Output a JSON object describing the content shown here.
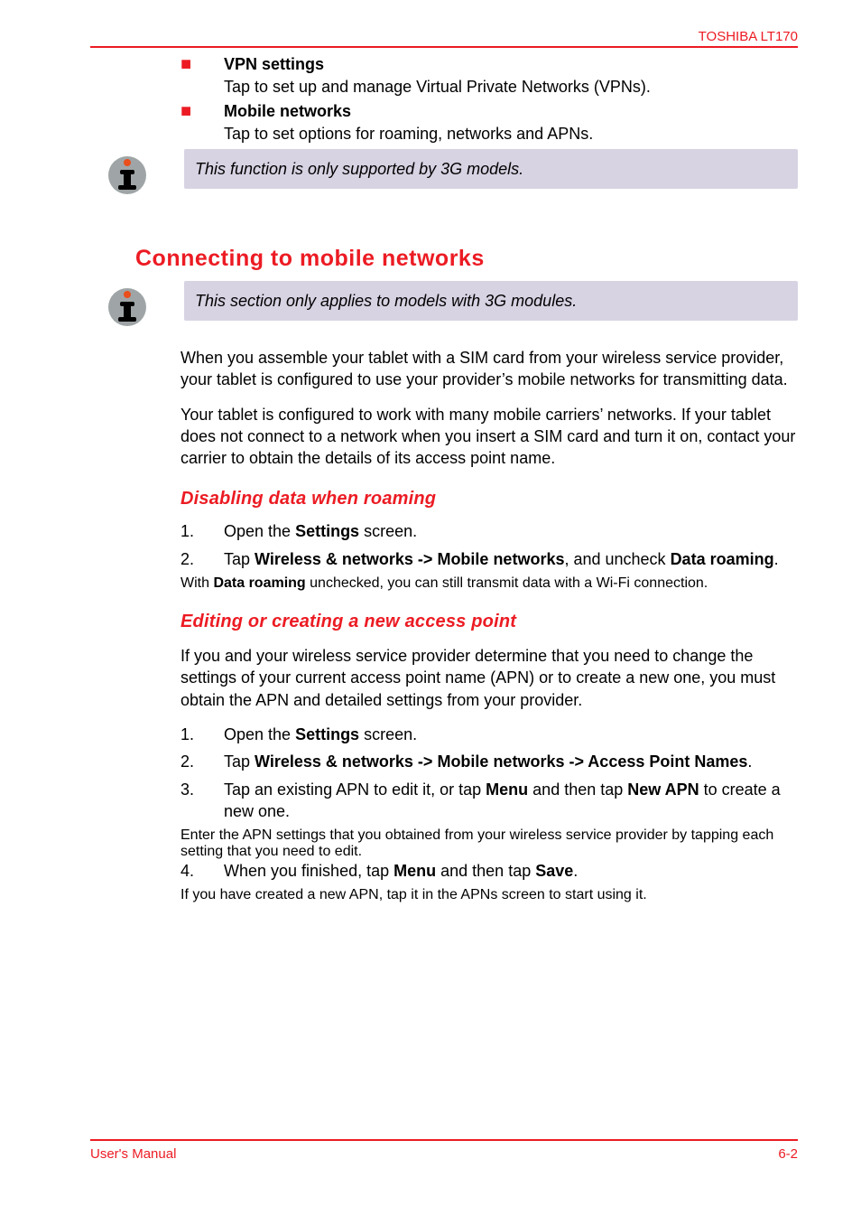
{
  "header": {
    "product": "TOSHIBA LT170"
  },
  "top_bullets": [
    {
      "label": "VPN settings",
      "desc": "Tap to set up and manage Virtual Private Networks (VPNs)."
    },
    {
      "label": "Mobile networks",
      "desc": "Tap to set options for roaming, networks and APNs."
    }
  ],
  "callout1": "This function is only supported by 3G models.",
  "section_title": "Connecting to mobile networks",
  "callout2": "This section only applies to models with 3G modules.",
  "para1": "When you assemble your tablet with a SIM card from your wireless service provider, your tablet is configured to use your provider’s mobile networks for transmitting data.",
  "para2": "Your tablet is configured to work with many mobile carriers’ networks. If your tablet does not connect to a network when you insert a SIM card and turn it on, contact your carrier to obtain the details of its access point name.",
  "sub1": {
    "heading": "Disabling data when roaming",
    "steps": [
      {
        "num": "1.",
        "parts": [
          "Open the ",
          "Settings",
          " screen."
        ]
      },
      {
        "num": "2.",
        "parts": [
          "Tap ",
          "Wireless & networks -> Mobile networks",
          ", and uncheck ",
          "Data roaming",
          "."
        ]
      }
    ],
    "note_pre": "With ",
    "note_bold": "Data roaming",
    "note_post": " unchecked, you can still transmit data with a Wi-Fi connection."
  },
  "sub2": {
    "heading": "Editing or creating a new access point",
    "intro": "If you and your wireless service provider determine that you need to change the settings of your current access point name (APN) or to create a new one, you must obtain the APN and detailed settings from your provider.",
    "steps": {
      "s1": {
        "num": "1.",
        "pre": "Open the ",
        "b1": "Settings",
        "post": " screen."
      },
      "s2": {
        "num": "2.",
        "pre": "Tap ",
        "b1": "Wireless & networks -> Mobile networks -> Access Point Names",
        "post": "."
      },
      "s3": {
        "num": "3.",
        "pre": "Tap an existing APN to edit it, or tap ",
        "b1": "Menu",
        "mid": " and then tap ",
        "b2": "New APN",
        "post": " to create a new one."
      },
      "s3_sub": "Enter the APN settings that you obtained from your wireless service provider by tapping each setting that you need to edit.",
      "s4": {
        "num": "4.",
        "pre": "When you finished, tap ",
        "b1": "Menu",
        "mid": " and then tap ",
        "b2": "Save",
        "post": "."
      },
      "s4_sub": "If you have created a new APN, tap it in the APNs screen to start using it."
    }
  },
  "footer": {
    "left": "User's Manual",
    "right": "6-2"
  }
}
